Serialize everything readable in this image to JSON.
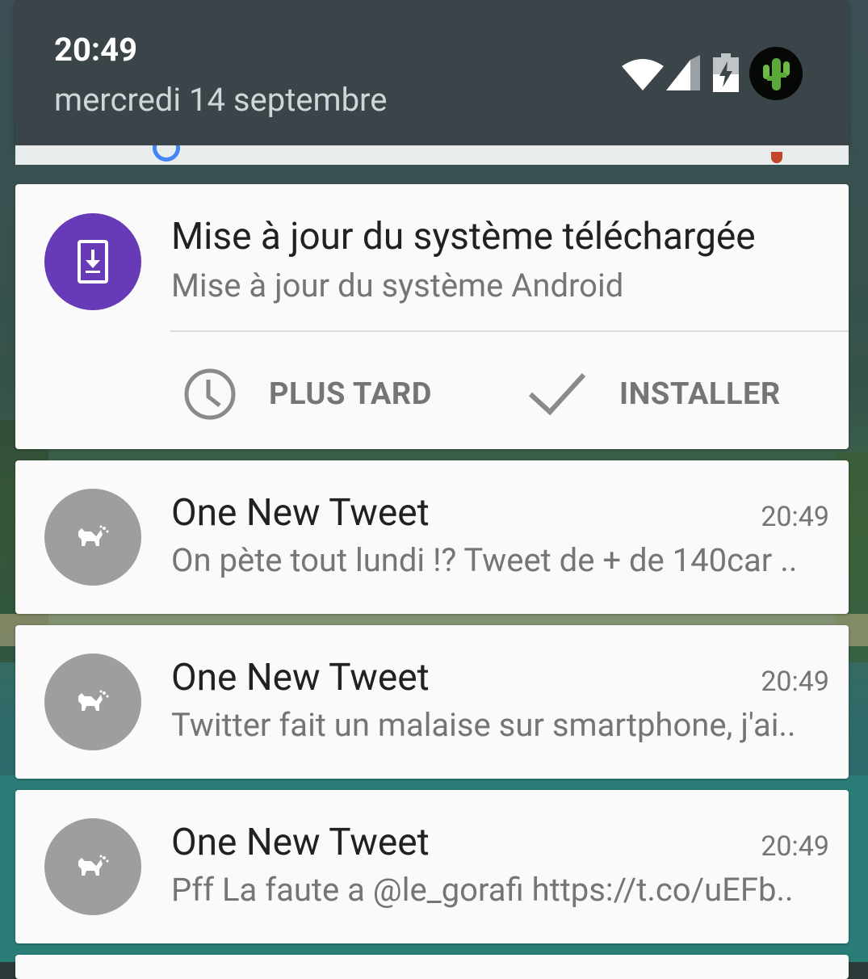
{
  "status_bar": {
    "time": "20:49",
    "date": "mercredi 14 septembre",
    "icons": [
      "wifi-icon",
      "signal-icon",
      "battery-charging-icon",
      "avatar-cactus"
    ]
  },
  "notifications": {
    "update": {
      "icon": "system-update-icon",
      "accent_color": "#673ab7",
      "title": "Mise à jour du système téléchargée",
      "subtitle": "Mise à jour du système Android",
      "actions": {
        "later": {
          "icon": "clock-icon",
          "label": "PLUS TARD"
        },
        "install": {
          "icon": "check-icon",
          "label": "INSTALLER"
        }
      }
    },
    "tweets": [
      {
        "icon": "fuzzy-app-icon",
        "title": "One New Tweet",
        "time": "20:49",
        "text": "On pète tout lundi !? Tweet de + de 140car .."
      },
      {
        "icon": "fuzzy-app-icon",
        "title": "One New Tweet",
        "time": "20:49",
        "text": "Twitter fait un malaise sur smartphone, j'ai.."
      },
      {
        "icon": "fuzzy-app-icon",
        "title": "One New Tweet",
        "time": "20:49",
        "text": "Pff La faute a @le_gorafi https://t.co/uEFb.."
      }
    ]
  }
}
